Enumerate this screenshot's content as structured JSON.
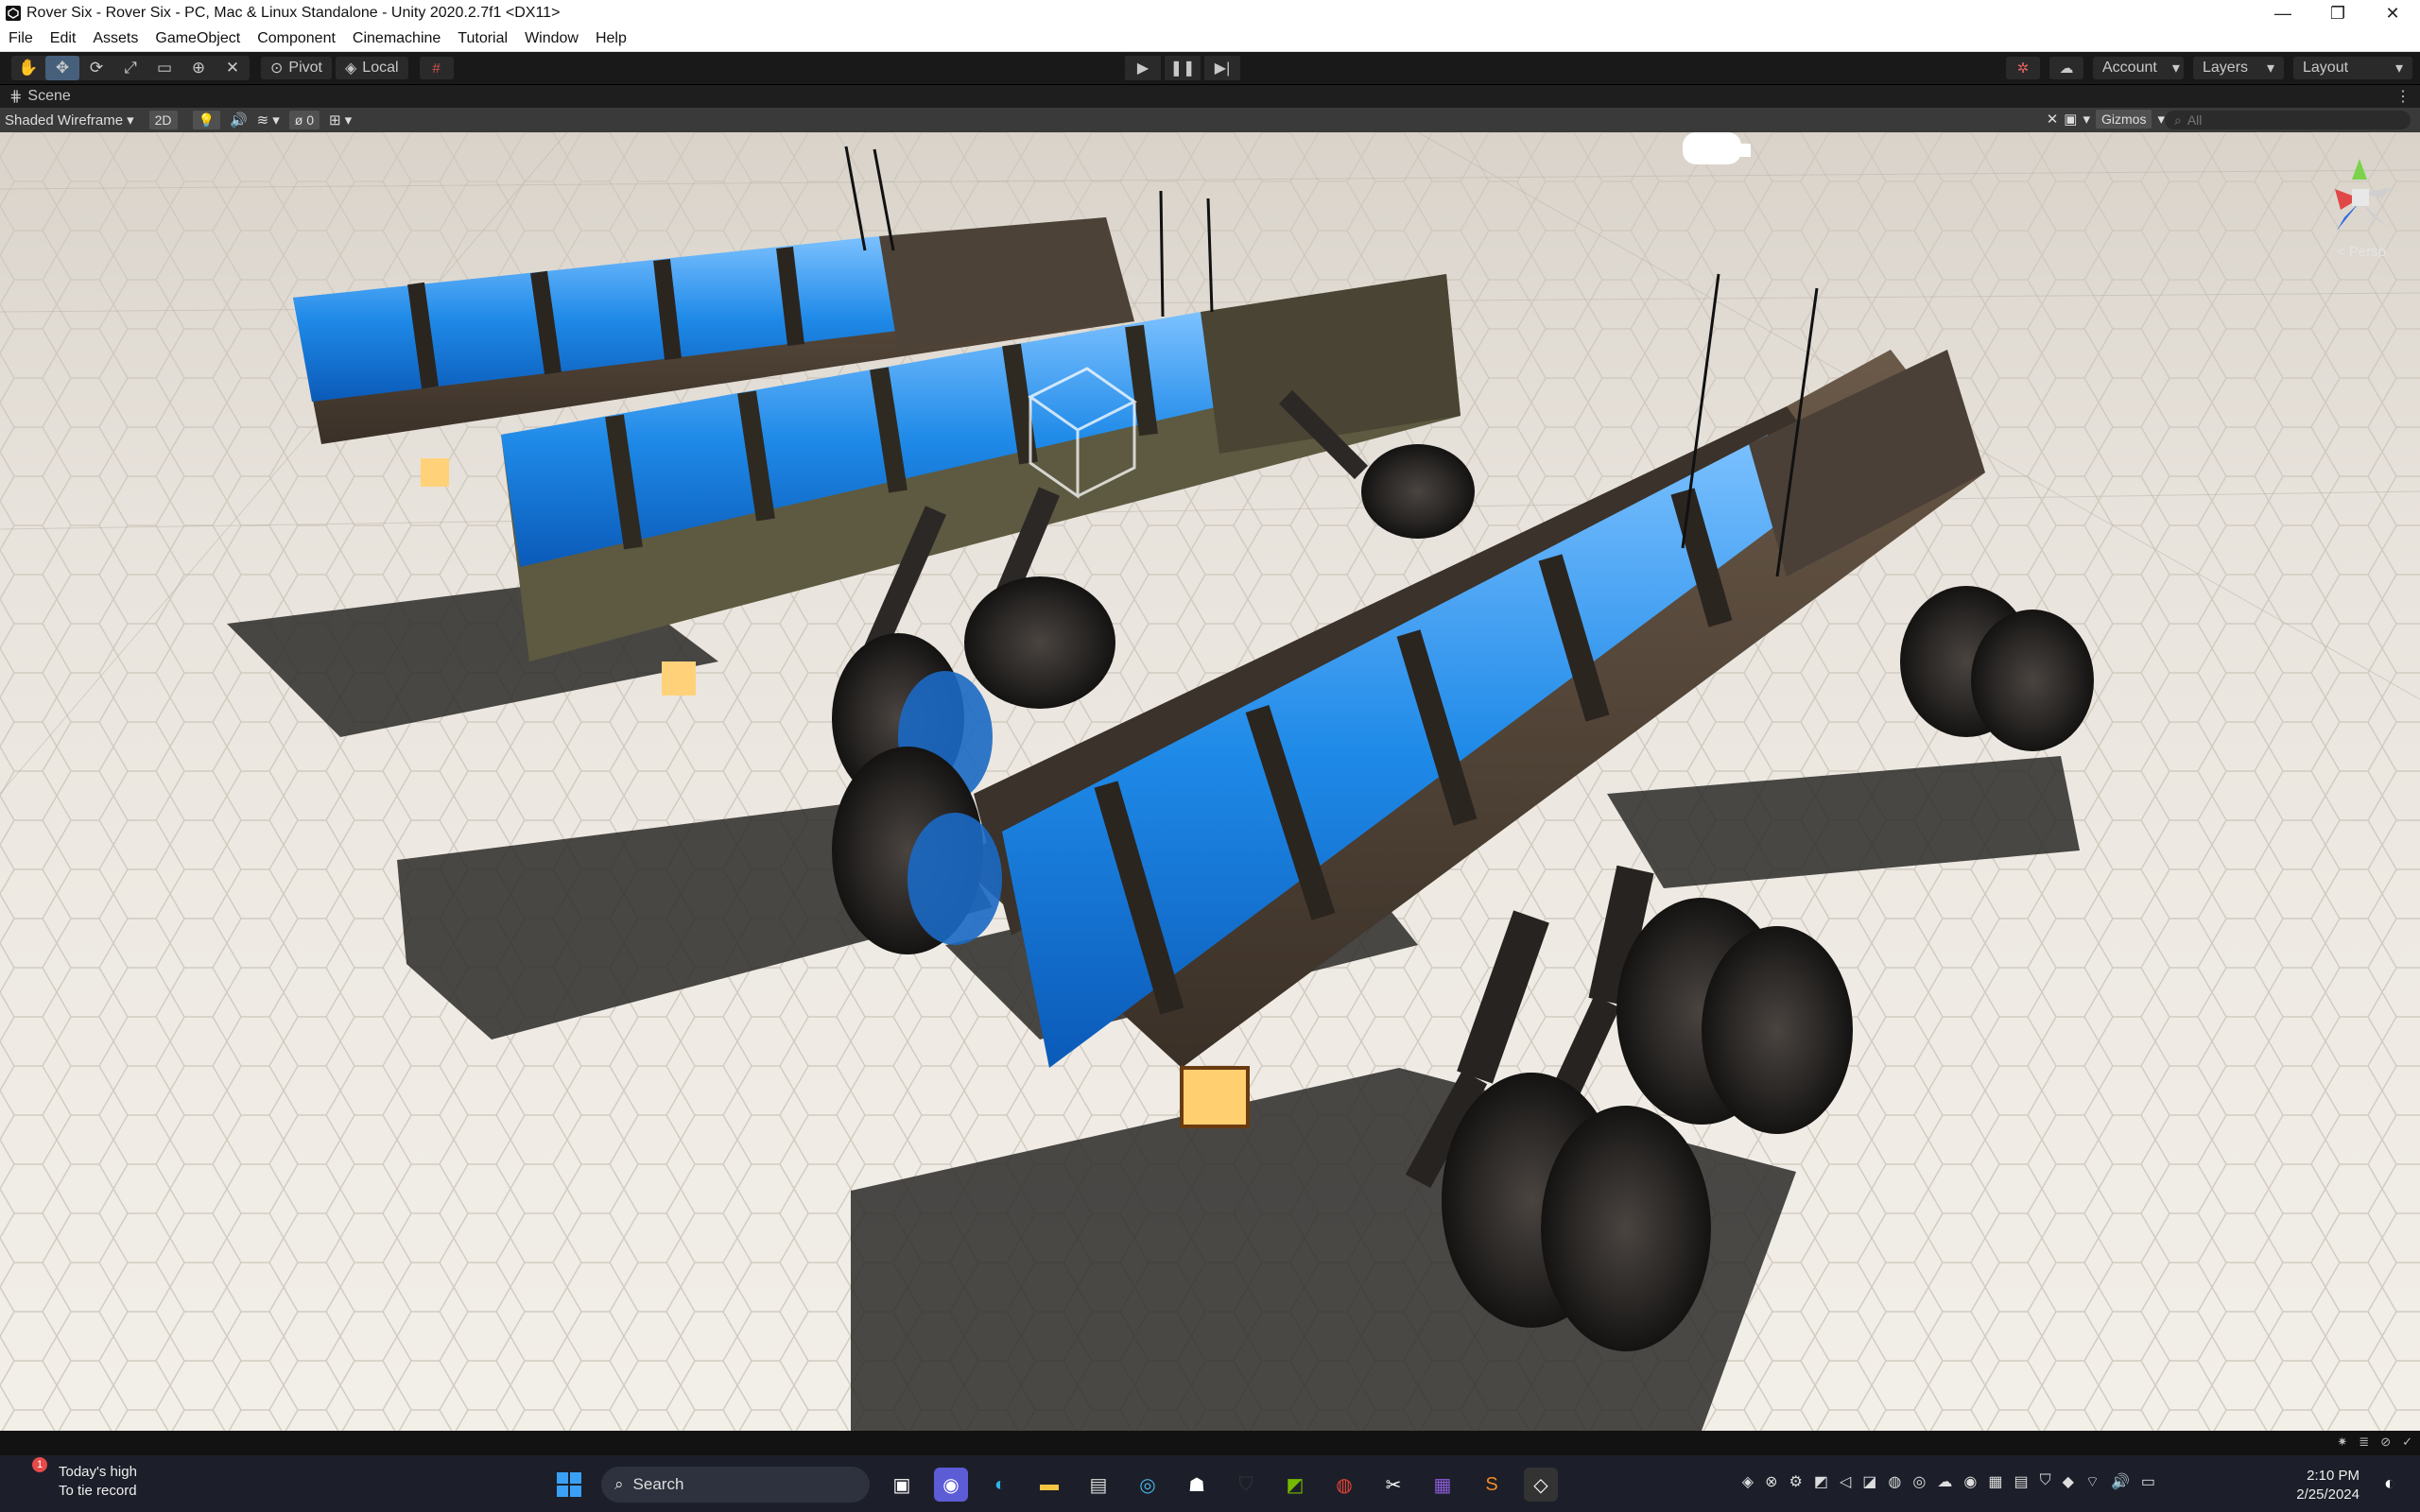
{
  "window": {
    "title": "Rover Six - Rover Six - PC, Mac & Linux Standalone - Unity 2020.2.7f1 <DX11>",
    "minimize": "—",
    "maximize": "❐",
    "close": "✕"
  },
  "menu": [
    "File",
    "Edit",
    "Assets",
    "GameObject",
    "Component",
    "Cinemachine",
    "Tutorial",
    "Window",
    "Help"
  ],
  "toolbar": {
    "pivot_label": "Pivot",
    "local_label": "Local",
    "account_label": "Account",
    "layers_label": "Layers",
    "layout_label": "Layout"
  },
  "scene_tab": {
    "label": "Scene"
  },
  "scene_bar": {
    "draw_mode": "Shaded Wireframe",
    "mode_2d": "2D",
    "hidden_count": "0",
    "gizmos_label": "Gizmos",
    "search_placeholder": "All"
  },
  "viewport": {
    "projection_label": "< Persp"
  },
  "taskbar": {
    "weather_line1": "Today's high",
    "weather_line2": "To tie record",
    "weather_badge": "1",
    "search_label": "Search",
    "time": "2:10 PM",
    "date": "2/25/2024"
  },
  "colors": {
    "accent_blue": "#1f8ae8",
    "editor_dark": "#191919",
    "tool_active": "#46607c"
  }
}
